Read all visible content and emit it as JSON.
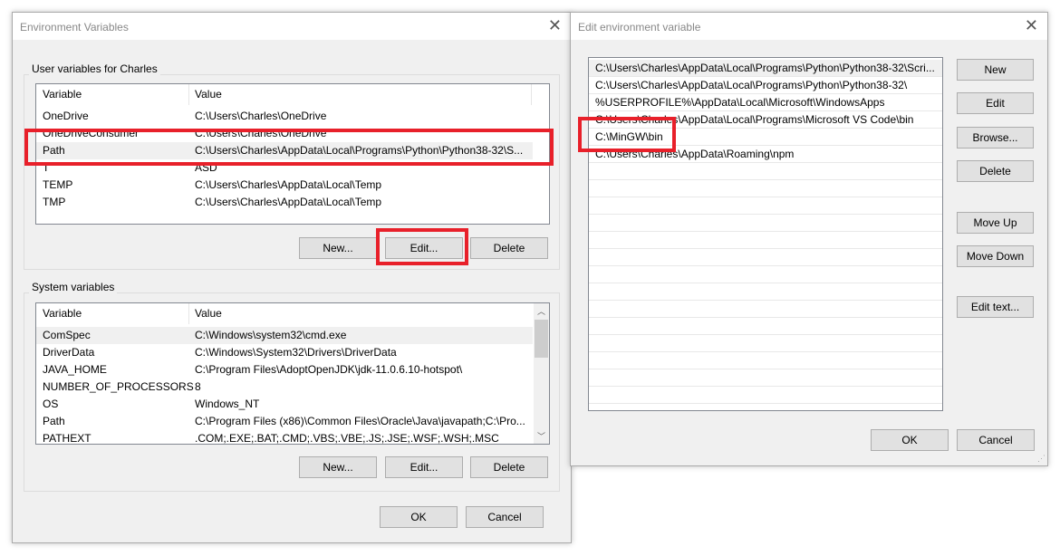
{
  "env_dialog": {
    "title": "Environment Variables",
    "user_group_label": "User variables for Charles",
    "system_group_label": "System variables",
    "col_variable": "Variable",
    "col_value": "Value",
    "user_vars": [
      {
        "name": "OneDrive",
        "value": "C:\\Users\\Charles\\OneDrive"
      },
      {
        "name": "OneDriveConsumer",
        "value": "C:\\Users\\Charles\\OneDrive"
      },
      {
        "name": "Path",
        "value": "C:\\Users\\Charles\\AppData\\Local\\Programs\\Python\\Python38-32\\S...",
        "selected": true
      },
      {
        "name": "T",
        "value": "ASD"
      },
      {
        "name": "TEMP",
        "value": "C:\\Users\\Charles\\AppData\\Local\\Temp"
      },
      {
        "name": "TMP",
        "value": "C:\\Users\\Charles\\AppData\\Local\\Temp"
      }
    ],
    "system_vars": [
      {
        "name": "ComSpec",
        "value": "C:\\Windows\\system32\\cmd.exe",
        "selected": true
      },
      {
        "name": "DriverData",
        "value": "C:\\Windows\\System32\\Drivers\\DriverData"
      },
      {
        "name": "JAVA_HOME",
        "value": "C:\\Program Files\\AdoptOpenJDK\\jdk-11.0.6.10-hotspot\\"
      },
      {
        "name": "NUMBER_OF_PROCESSORS",
        "value": "8"
      },
      {
        "name": "OS",
        "value": "Windows_NT"
      },
      {
        "name": "Path",
        "value": "C:\\Program Files (x86)\\Common Files\\Oracle\\Java\\javapath;C:\\Pro..."
      },
      {
        "name": "PATHEXT",
        "value": ".COM;.EXE;.BAT;.CMD;.VBS;.VBE;.JS;.JSE;.WSF;.WSH;.MSC"
      }
    ],
    "user_buttons": {
      "new": "New...",
      "edit": "Edit...",
      "delete": "Delete"
    },
    "system_buttons": {
      "new": "New...",
      "edit": "Edit...",
      "delete": "Delete"
    },
    "ok": "OK",
    "cancel": "Cancel"
  },
  "edit_dialog": {
    "title": "Edit environment variable",
    "entries": [
      "C:\\Users\\Charles\\AppData\\Local\\Programs\\Python\\Python38-32\\Scri...",
      "C:\\Users\\Charles\\AppData\\Local\\Programs\\Python\\Python38-32\\",
      "%USERPROFILE%\\AppData\\Local\\Microsoft\\WindowsApps",
      "C:\\Users\\Charles\\AppData\\Local\\Programs\\Microsoft VS Code\\bin",
      "C:\\MinGW\\bin",
      "C:\\Users\\Charles\\AppData\\Roaming\\npm"
    ],
    "buttons": {
      "new": "New",
      "edit": "Edit",
      "browse": "Browse...",
      "delete": "Delete",
      "move_up": "Move Up",
      "move_down": "Move Down",
      "edit_text": "Edit text..."
    },
    "ok": "OK",
    "cancel": "Cancel"
  },
  "highlight_color": "#e8202a"
}
